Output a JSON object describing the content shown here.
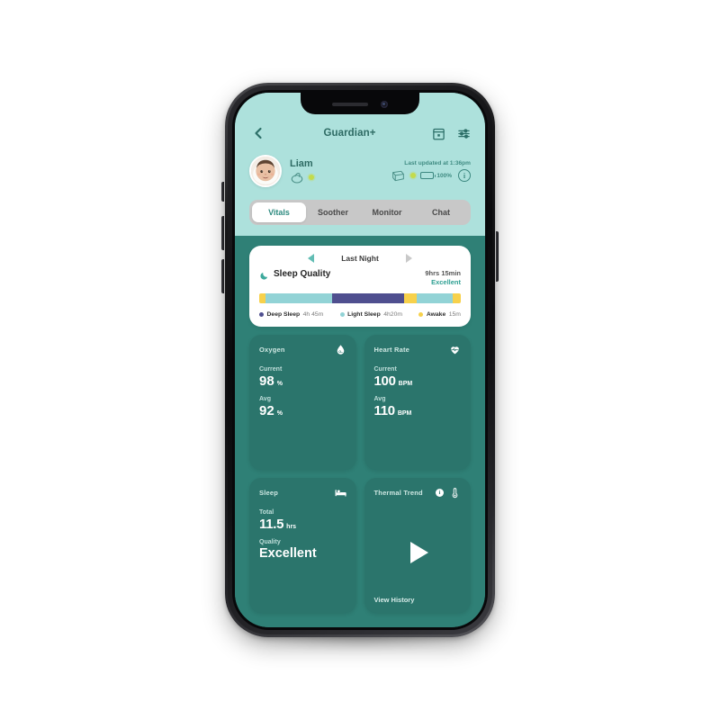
{
  "header": {
    "title": "Guardian+",
    "back_icon": "chevron-left-icon",
    "calendar_icon": "calendar-icon",
    "settings_icon": "sliders-icon"
  },
  "profile": {
    "avatar_icon": "baby-avatar-photo",
    "name": "Liam",
    "soother_icon": "pacifier-icon",
    "soother_status": "active",
    "last_updated": "Last updated at 1:36pm",
    "diaper_icon": "diaper-icon",
    "diaper_status": "active",
    "battery_icon": "battery-icon",
    "battery_level": "100%",
    "info_icon": "i",
    "status_dot_color": "#C3DB4C"
  },
  "tabs": [
    {
      "label": "Vitals",
      "active": true
    },
    {
      "label": "Soother",
      "active": false
    },
    {
      "label": "Monitor",
      "active": false
    },
    {
      "label": "Chat",
      "active": false
    }
  ],
  "sleep_card": {
    "prev_icon": "caret-left-icon",
    "next_icon": "caret-right-icon",
    "night_label": "Last Night",
    "moon_icon": "moon-icon",
    "title": "Sleep Quality",
    "duration": "9hrs 15min",
    "rating": "Excellent",
    "segments": [
      {
        "type": "Awake",
        "color": "#F7D14B",
        "pct": 3
      },
      {
        "type": "Light Sleep",
        "color": "#92D3D6",
        "pct": 33
      },
      {
        "type": "Deep Sleep",
        "color": "#4F4F8F",
        "pct": 36
      },
      {
        "type": "Awake",
        "color": "#F7D14B",
        "pct": 6
      },
      {
        "type": "Light Sleep",
        "color": "#92D3D6",
        "pct": 18
      },
      {
        "type": "Awake",
        "color": "#F7D14B",
        "pct": 4
      }
    ],
    "legend": [
      {
        "name": "Deep Sleep",
        "value": "4h 45m",
        "color": "#4F4F8F"
      },
      {
        "name": "Light Sleep",
        "value": "4h20m",
        "color": "#92D3D6"
      },
      {
        "name": "Awake",
        "value": "15m",
        "color": "#F7D14B"
      }
    ]
  },
  "metrics": {
    "oxygen": {
      "title": "Oxygen",
      "icon": "oxygen-drop-icon",
      "current_label": "Current",
      "current_value": "98",
      "current_unit": "%",
      "avg_label": "Avg",
      "avg_value": "92",
      "avg_unit": "%"
    },
    "heart_rate": {
      "title": "Heart Rate",
      "icon": "heart-pulse-icon",
      "current_label": "Current",
      "current_value": "100",
      "current_unit": "BPM",
      "avg_label": "Avg",
      "avg_value": "110",
      "avg_unit": "BPM"
    },
    "sleep": {
      "title": "Sleep",
      "icon": "bed-icon",
      "total_label": "Total",
      "total_value": "11.5",
      "total_unit": "hrs",
      "quality_label": "Quality",
      "quality_value": "Excellent"
    },
    "thermal": {
      "title": "Thermal Trend",
      "info_icon": "i",
      "icon": "thermometer-icon",
      "play_icon": "play-icon",
      "view_history": "View History"
    }
  },
  "colors": {
    "screen_bg": "#2F8076",
    "top_bg": "#ADE1DC",
    "card_teal": "#2B756C",
    "accent_teal": "#2FA093",
    "white": "#FFFFFF"
  }
}
